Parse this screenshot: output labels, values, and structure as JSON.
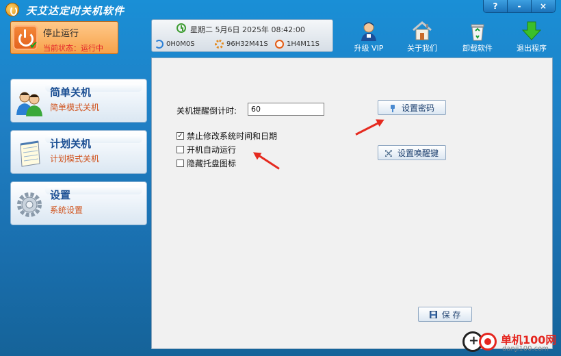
{
  "app": {
    "title": "天艾达定时关机软件",
    "window_buttons": [
      "?",
      "-",
      "×"
    ]
  },
  "status": {
    "title": "停止运行",
    "subtitle": "当前状态：运行中"
  },
  "clock": {
    "datetime": "星期二 5月6日 2025年 08:42:00",
    "stats": [
      {
        "icon": "water-icon",
        "value": "0H0M0S"
      },
      {
        "icon": "gear-icon",
        "value": "96H32M41S"
      },
      {
        "icon": "power-icon",
        "value": "1H4M11S"
      }
    ]
  },
  "toolbar": {
    "upgrade_label": "升级 VIP",
    "about_label": "关于我们",
    "uninstall_label": "卸载软件",
    "exit_label": "退出程序"
  },
  "sidebar": {
    "items": [
      {
        "title": "简单关机",
        "subtitle": "简单模式关机",
        "icon": "people-icon"
      },
      {
        "title": "计划关机",
        "subtitle": "计划模式关机",
        "icon": "notepad-icon"
      },
      {
        "title": "设置",
        "subtitle": "系统设置",
        "icon": "gear-icon"
      }
    ]
  },
  "settings": {
    "countdown_label": "关机提醒倒计时:",
    "countdown_value": "60",
    "options": [
      {
        "label": "禁止修改系统时间和日期",
        "checked": true
      },
      {
        "label": "开机自动运行",
        "checked": false
      },
      {
        "label": "隐藏托盘图标",
        "checked": false
      }
    ],
    "set_password_label": "设置密码",
    "set_wake_key_label": "设置唤醒键",
    "save_label": "保 存",
    "checked_mark": "✓"
  },
  "watermark": {
    "text": "单机100网",
    "sub": "danji100.com"
  },
  "colors": {
    "accent": "#1a7fc8",
    "status_orange": "#f7a24a",
    "arrow_red": "#e52a1f"
  }
}
